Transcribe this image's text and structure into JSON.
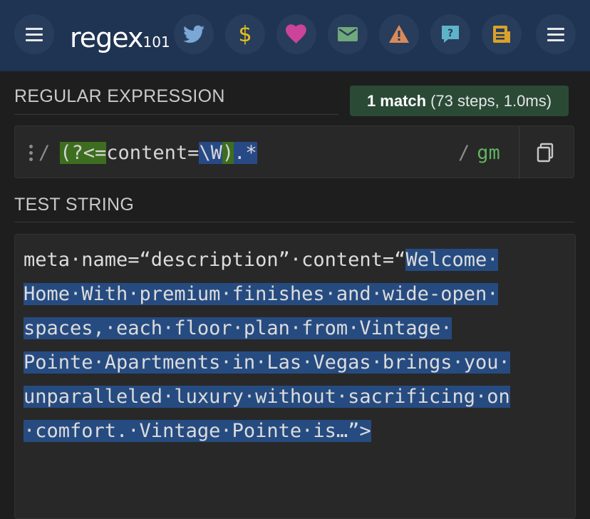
{
  "app": {
    "logo_main": "regex",
    "logo_sub": "101",
    "nav_icons": [
      {
        "name": "twitter-icon",
        "glyph": "🐦",
        "color": "#7aa7d6"
      },
      {
        "name": "dollar-icon",
        "glyph": "$",
        "color": "#e6c11a"
      },
      {
        "name": "heart-icon",
        "glyph": "♥",
        "color": "#cc4499"
      },
      {
        "name": "mail-icon",
        "glyph": "✉",
        "color": "#6fa87a"
      },
      {
        "name": "warning-icon",
        "glyph": "⚠",
        "color": "#d98a5a"
      },
      {
        "name": "help-icon",
        "glyph": "?",
        "color": "#5fb3c9"
      },
      {
        "name": "news-icon",
        "glyph": "📰",
        "color": "#d9a22a"
      }
    ]
  },
  "regex_section": {
    "title": "REGULAR EXPRESSION",
    "match_count": "1 match",
    "match_detail": "(73 steps, 1.0ms)",
    "delimiter": "/",
    "pattern_parts": [
      "(?<=",
      "content=",
      "\\W",
      ")",
      ".*"
    ],
    "flags": "gm"
  },
  "test_section": {
    "title": "TEST STRING",
    "lines": [
      {
        "pre": "meta·name=“description”·content=“",
        "match": "Welcome·"
      },
      {
        "pre": "",
        "match": "Home·With·premium·finishes·and·wide-open·"
      },
      {
        "pre": "",
        "match": "spaces,·each·floor·plan·from·Vintage·"
      },
      {
        "pre": "",
        "match": "Pointe·Apartments·in·Las·Vegas·brings·you·"
      },
      {
        "pre": "",
        "match": "unparalleled·luxury·without·sacrificing·on"
      },
      {
        "pre": "",
        "match": "·comfort.·Vintage·Pointe·is…”>"
      }
    ]
  },
  "colors": {
    "topbar": "#1f3352",
    "match_badge": "#2a4a36",
    "highlight_green": "#3d6e1f",
    "highlight_blue": "#274a87",
    "selection": "#264b80"
  }
}
